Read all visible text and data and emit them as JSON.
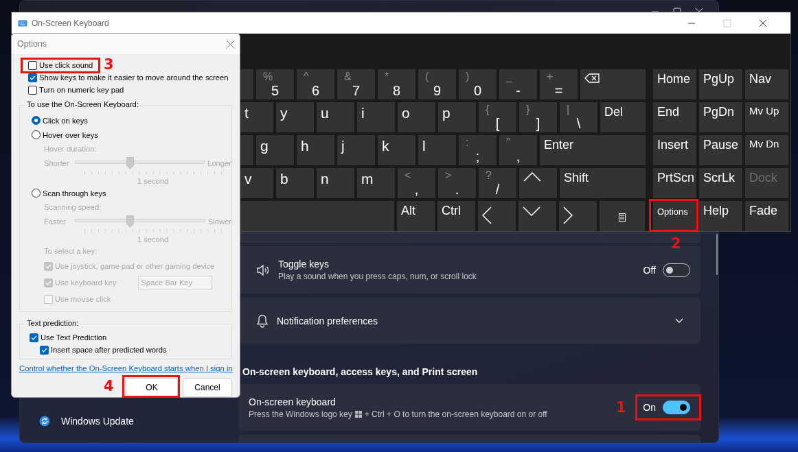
{
  "settings": {
    "sidebar_item": {
      "label": "Windows Update"
    },
    "cards": [
      {
        "kind": "icon-toggle",
        "title": "Toggle keys",
        "description": [
          "Play a sound when you press caps, num, or scroll lock"
        ],
        "state_label": "Off",
        "on": false
      },
      {
        "kind": "icon-expander",
        "title": "Notification preferences"
      }
    ],
    "heading": "On-screen keyboard, access keys, and Print screen",
    "cards_2": [
      {
        "kind": "toggle",
        "title": "On-screen keyboard",
        "description": [
          "Press the Windows logo key",
          "+ Ctrl + O to turn the on-screen keyboard on or off"
        ],
        "state_label": "On",
        "on": true
      }
    ]
  },
  "keyboard": {
    "title": "On-Screen Keyboard",
    "rows": [
      [
        {
          "kind": "blank"
        },
        {
          "kind": "char",
          "shift": "%",
          "label": "5"
        },
        {
          "kind": "char",
          "shift": "^",
          "label": "6"
        },
        {
          "kind": "char",
          "shift": "&",
          "label": "7"
        },
        {
          "kind": "char",
          "shift": "*",
          "label": "8"
        },
        {
          "kind": "char",
          "shift": "(",
          "label": "9"
        },
        {
          "kind": "char",
          "shift": ")",
          "label": "0"
        },
        {
          "kind": "char",
          "shift": "_",
          "label": "-"
        },
        {
          "kind": "char",
          "shift": "+",
          "label": "="
        },
        {
          "kind": "backspace"
        }
      ],
      [
        {
          "kind": "letter",
          "label": "t"
        },
        {
          "kind": "letter",
          "label": "y"
        },
        {
          "kind": "letter",
          "label": "u"
        },
        {
          "kind": "letter",
          "label": "i"
        },
        {
          "kind": "letter",
          "label": "o"
        },
        {
          "kind": "letter",
          "label": "p"
        },
        {
          "kind": "char",
          "shift": "{",
          "label": "["
        },
        {
          "kind": "char",
          "shift": "}",
          "label": "]"
        },
        {
          "kind": "char",
          "shift": "|",
          "label": "\\"
        },
        {
          "kind": "word",
          "label": "Del"
        }
      ],
      [
        {
          "kind": "blank"
        },
        {
          "kind": "letter",
          "label": "g"
        },
        {
          "kind": "letter",
          "label": "h"
        },
        {
          "kind": "letter",
          "label": "j"
        },
        {
          "kind": "letter",
          "label": "k"
        },
        {
          "kind": "letter",
          "label": "l"
        },
        {
          "kind": "char",
          "shift": ":",
          "label": ";"
        },
        {
          "kind": "char",
          "shift": "\"",
          "label": ","
        },
        {
          "kind": "word",
          "label": "Enter"
        }
      ],
      [
        {
          "kind": "letter",
          "label": "v"
        },
        {
          "kind": "letter",
          "label": "b"
        },
        {
          "kind": "letter",
          "label": "n"
        },
        {
          "kind": "letter",
          "label": "m"
        },
        {
          "kind": "char",
          "shift": "<",
          "label": ","
        },
        {
          "kind": "char",
          "shift": ">",
          "label": "."
        },
        {
          "kind": "char",
          "shift": "?",
          "label": "/"
        },
        {
          "kind": "up"
        },
        {
          "kind": "word",
          "label": "Shift"
        }
      ],
      [
        {
          "kind": "blank"
        },
        {
          "kind": "word",
          "label": "Alt"
        },
        {
          "kind": "word",
          "label": "Ctrl"
        },
        {
          "kind": "left"
        },
        {
          "kind": "down"
        },
        {
          "kind": "right"
        },
        {
          "kind": "menu"
        }
      ]
    ],
    "side_rows": [
      [
        {
          "kind": "word",
          "label": "Home",
          "disabled": false
        },
        {
          "kind": "word",
          "label": "PgUp",
          "disabled": false
        },
        {
          "kind": "word",
          "label": "Nav",
          "disabled": false
        }
      ],
      [
        {
          "kind": "word",
          "label": "End",
          "disabled": false
        },
        {
          "kind": "word",
          "label": "PgDn",
          "disabled": false
        },
        {
          "kind": "small",
          "label": "Mv Up",
          "disabled": false
        }
      ],
      [
        {
          "kind": "word",
          "label": "Insert",
          "disabled": false
        },
        {
          "kind": "word",
          "label": "Pause",
          "disabled": false
        },
        {
          "kind": "small",
          "label": "Mv Dn",
          "disabled": false
        }
      ],
      [
        {
          "kind": "word",
          "label": "PrtScn",
          "disabled": false
        },
        {
          "kind": "word",
          "label": "ScrLk",
          "disabled": false
        },
        {
          "kind": "word",
          "label": "Dock",
          "disabled": true
        }
      ],
      [
        {
          "kind": "tiny",
          "label": "Options",
          "disabled": false
        },
        {
          "kind": "word",
          "label": "Help",
          "disabled": false
        },
        {
          "kind": "word",
          "label": "Fade",
          "disabled": false
        }
      ]
    ]
  },
  "dialog": {
    "title": "Options",
    "top_options": [
      {
        "label": "Use click sound",
        "checked": false
      },
      {
        "label": "Show keys to make it easier to move around the screen",
        "checked": true
      },
      {
        "label": "Turn on numeric key pad",
        "checked": false
      }
    ],
    "use_group": {
      "legend": "To use the On-Screen Keyboard:",
      "items": [
        {
          "kind": "radio",
          "label": "Click on keys",
          "selected": true
        },
        {
          "kind": "radio",
          "label": "Hover over keys",
          "selected": false
        },
        {
          "kind": "caption",
          "label": "Hover duration:",
          "disabled": true
        },
        {
          "kind": "slider",
          "min_label": "Shorter",
          "max_label": "Longer",
          "level": 0.42,
          "reading": "1 second",
          "disabled": true
        },
        {
          "kind": "radio",
          "label": "Scan through keys",
          "selected": false
        },
        {
          "kind": "caption",
          "label": "Scanning speed:",
          "disabled": true
        },
        {
          "kind": "slider",
          "min_label": "Faster",
          "max_label": "Slower",
          "level": 0.42,
          "reading": "1 second",
          "disabled": true
        },
        {
          "kind": "caption",
          "label": "To select a key:",
          "disabled": true
        },
        {
          "kind": "check",
          "label": "Use joystick, game pad or other gaming device",
          "checked": true,
          "disabled": true
        },
        {
          "kind": "check",
          "label": "Use keyboard key",
          "checked": true,
          "disabled": true,
          "dropdown": "Space Bar Key"
        },
        {
          "kind": "check",
          "label": "Use mouse click",
          "checked": false,
          "disabled": true
        }
      ]
    },
    "prediction_group": {
      "legend": "Text prediction:",
      "items": [
        {
          "label": "Use Text Prediction",
          "checked": true,
          "children": [
            {
              "label": "Insert space after predicted words",
              "checked": true
            }
          ]
        }
      ]
    },
    "link": "Control whether the On-Screen Keyboard starts when I sign in",
    "buttons": [
      "OK",
      "Cancel"
    ]
  },
  "annotations": [
    {
      "number": "1"
    },
    {
      "number": "2"
    },
    {
      "number": "3"
    },
    {
      "number": "4"
    }
  ]
}
